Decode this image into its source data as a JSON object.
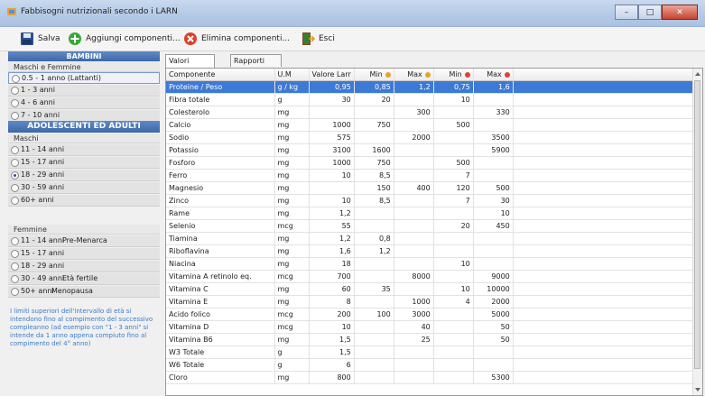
{
  "window": {
    "title": "Fabbisogni nutrizionali secondo i LARN",
    "min_glyph": "–",
    "max_glyph": "□",
    "close_glyph": "✕"
  },
  "toolbar": {
    "save_label": "Salva",
    "add_label": "Aggiungi componenti...",
    "delete_label": "Elimina componenti...",
    "exit_label": "Esci"
  },
  "left": {
    "bambini_header": "BAMBINI",
    "maschi_femmine": "Maschi e Femmine",
    "bambini_items": [
      {
        "label": "0.5 - 1 anno (Lattanti)",
        "selected": false
      },
      {
        "label": "1 - 3 anni",
        "selected": false
      },
      {
        "label": "4 - 6 anni",
        "selected": false
      },
      {
        "label": "7 - 10 anni",
        "selected": false
      }
    ],
    "adulti_header": "ADOLESCENTI ED ADULTI",
    "maschi": "Maschi",
    "maschi_items": [
      {
        "label": "11 - 14 anni",
        "selected": false
      },
      {
        "label": "15 - 17 anni",
        "selected": false
      },
      {
        "label": "18 - 29 anni",
        "selected": true
      },
      {
        "label": "30 - 59 anni",
        "selected": false
      },
      {
        "label": "60+ anni",
        "selected": false
      }
    ],
    "femmine": "Femmine",
    "femmine_items": [
      {
        "label": "11 - 14 anni",
        "note": "Pre-Menarca",
        "selected": false
      },
      {
        "label": "15 - 17 anni",
        "note": "",
        "selected": false
      },
      {
        "label": "18 - 29 anni",
        "note": "",
        "selected": false
      },
      {
        "label": "30 - 49 anni",
        "note": "Età fertile",
        "selected": false
      },
      {
        "label": "50+ anni",
        "note": "Menopausa",
        "selected": false
      }
    ],
    "note": "I limiti superiori dell'intervallo di età si intendono fino al compimento del successivo compleanno (ad esempio con \"1 - 3 anni\" si intende da 1 anno appena compiuto fino al compimento del 4° anno)"
  },
  "tabs": [
    "Valori componenti",
    "Rapporti Componenti"
  ],
  "table": {
    "headers": [
      "Componente",
      "U.M",
      "Valore Larr",
      "Min",
      "Max",
      "Min",
      "Max"
    ],
    "header_dot_colors": [
      "",
      "",
      "",
      "#f0a020",
      "#f0a020",
      "#e0403a",
      "#e0403a"
    ],
    "rows": [
      [
        "Proteine / Peso",
        "g / kg",
        "0,95",
        "0,85",
        "1,2",
        "0,75",
        "1,6"
      ],
      [
        "Fibra totale",
        "g",
        "30",
        "20",
        "",
        "10",
        ""
      ],
      [
        "Colesterolo",
        "mg",
        "",
        "",
        "300",
        "",
        "330"
      ],
      [
        "Calcio",
        "mg",
        "1000",
        "750",
        "",
        "500",
        ""
      ],
      [
        "Sodio",
        "mg",
        "575",
        "",
        "2000",
        "",
        "3500"
      ],
      [
        "Potassio",
        "mg",
        "3100",
        "1600",
        "",
        "",
        "5900"
      ],
      [
        "Fosforo",
        "mg",
        "1000",
        "750",
        "",
        "500",
        ""
      ],
      [
        "Ferro",
        "mg",
        "10",
        "8,5",
        "",
        "7",
        ""
      ],
      [
        "Magnesio",
        "mg",
        "",
        "150",
        "400",
        "120",
        "500"
      ],
      [
        "Zinco",
        "mg",
        "10",
        "8,5",
        "",
        "7",
        "30"
      ],
      [
        "Rame",
        "mg",
        "1,2",
        "",
        "",
        "",
        "10"
      ],
      [
        "Selenio",
        "mcg",
        "55",
        "",
        "",
        "20",
        "450"
      ],
      [
        "Tiamina",
        "mg",
        "1,2",
        "0,8",
        "",
        "",
        ""
      ],
      [
        "Riboflavina",
        "mg",
        "1,6",
        "1,2",
        "",
        "",
        ""
      ],
      [
        "Niacina",
        "mg",
        "18",
        "",
        "",
        "10",
        ""
      ],
      [
        "Vitamina A retinolo eq.",
        "mcg",
        "700",
        "",
        "8000",
        "",
        "9000"
      ],
      [
        "Vitamina C",
        "mg",
        "60",
        "35",
        "",
        "10",
        "10000"
      ],
      [
        "Vitamina E",
        "mg",
        "8",
        "",
        "1000",
        "4",
        "2000"
      ],
      [
        "Acido folico",
        "mcg",
        "200",
        "100",
        "3000",
        "",
        "5000"
      ],
      [
        "Vitamina D",
        "mcg",
        "10",
        "",
        "40",
        "",
        "50"
      ],
      [
        "Vitamina B6",
        "mg",
        "1,5",
        "",
        "25",
        "",
        "50"
      ],
      [
        "W3 Totale",
        "g",
        "1,5",
        "",
        "",
        "",
        ""
      ],
      [
        "W6 Totale",
        "g",
        "6",
        "",
        "",
        "",
        ""
      ],
      [
        "Cloro",
        "mg",
        "800",
        "",
        "",
        "",
        "5300"
      ]
    ]
  }
}
